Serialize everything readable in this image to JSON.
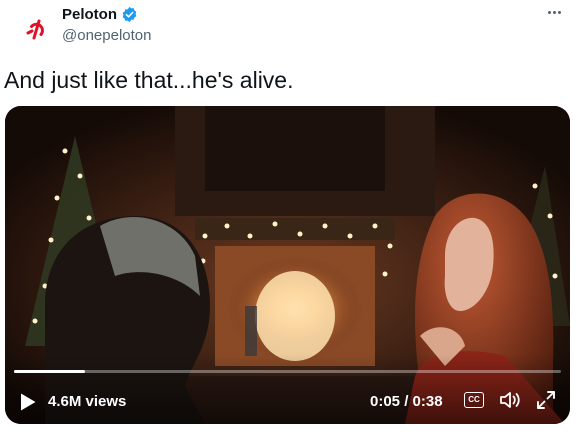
{
  "author": {
    "display_name": "Peloton",
    "handle": "@onepeloton",
    "verified": true,
    "avatar_icon": "peloton-logo-icon",
    "brand_color": "#e0112b"
  },
  "tweet": {
    "text": "And just like that...he's alive."
  },
  "video": {
    "views": "4.6M views",
    "time": "0:05 / 0:38",
    "progress": 0.13,
    "captions_label": "CC",
    "controls": [
      "play-icon",
      "captions-icon",
      "volume-icon",
      "fullscreen-icon"
    ]
  },
  "colors": {
    "verified_blue": "#1d9bf0",
    "text_primary": "#0f1419",
    "text_secondary": "#536471"
  }
}
